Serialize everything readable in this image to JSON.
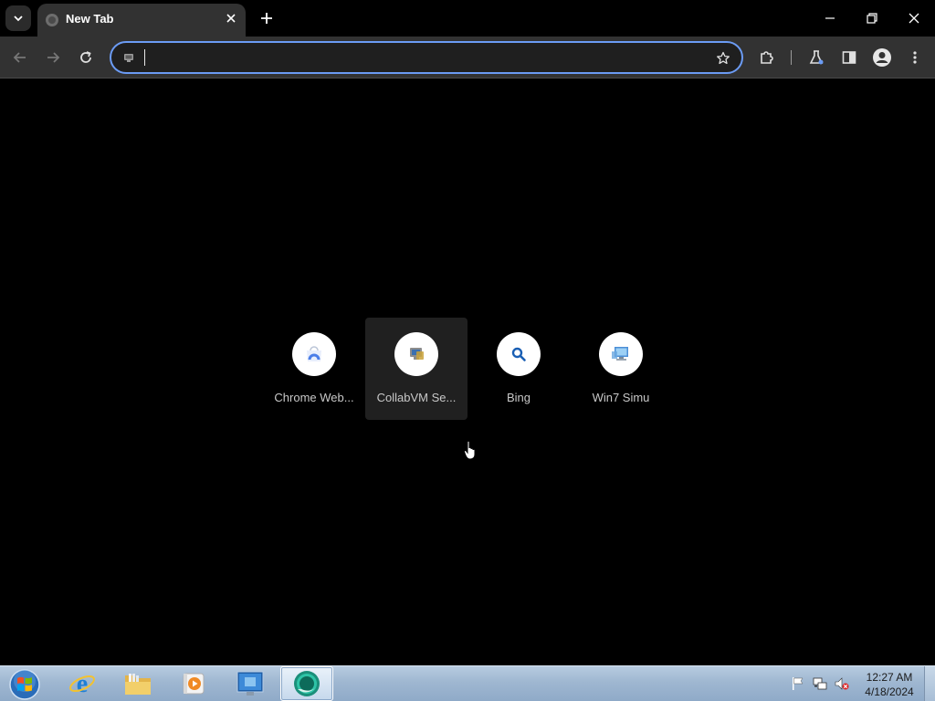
{
  "browser": {
    "tab": {
      "title": "New Tab"
    },
    "omnibox": {
      "value": "",
      "placeholder": ""
    }
  },
  "shortcuts": [
    {
      "label": "Chrome Web...",
      "icon": "chrome-web-store-icon"
    },
    {
      "label": "CollabVM Se...",
      "icon": "collabvm-icon"
    },
    {
      "label": "Bing",
      "icon": "bing-search-icon"
    },
    {
      "label": "Win7 Simu",
      "icon": "win7-simu-icon"
    }
  ],
  "taskbar": {
    "apps": [
      "windows-start-icon",
      "internet-explorer-icon",
      "file-explorer-icon",
      "media-player-icon",
      "remote-desktop-icon",
      "chrome-icon"
    ],
    "clock": {
      "time": "12:27 AM",
      "date": "4/18/2024"
    }
  },
  "colors": {
    "accent": "#6b9bf4",
    "toolbar": "#323232",
    "background": "#000000",
    "taskbar": "#a5bdd6"
  }
}
